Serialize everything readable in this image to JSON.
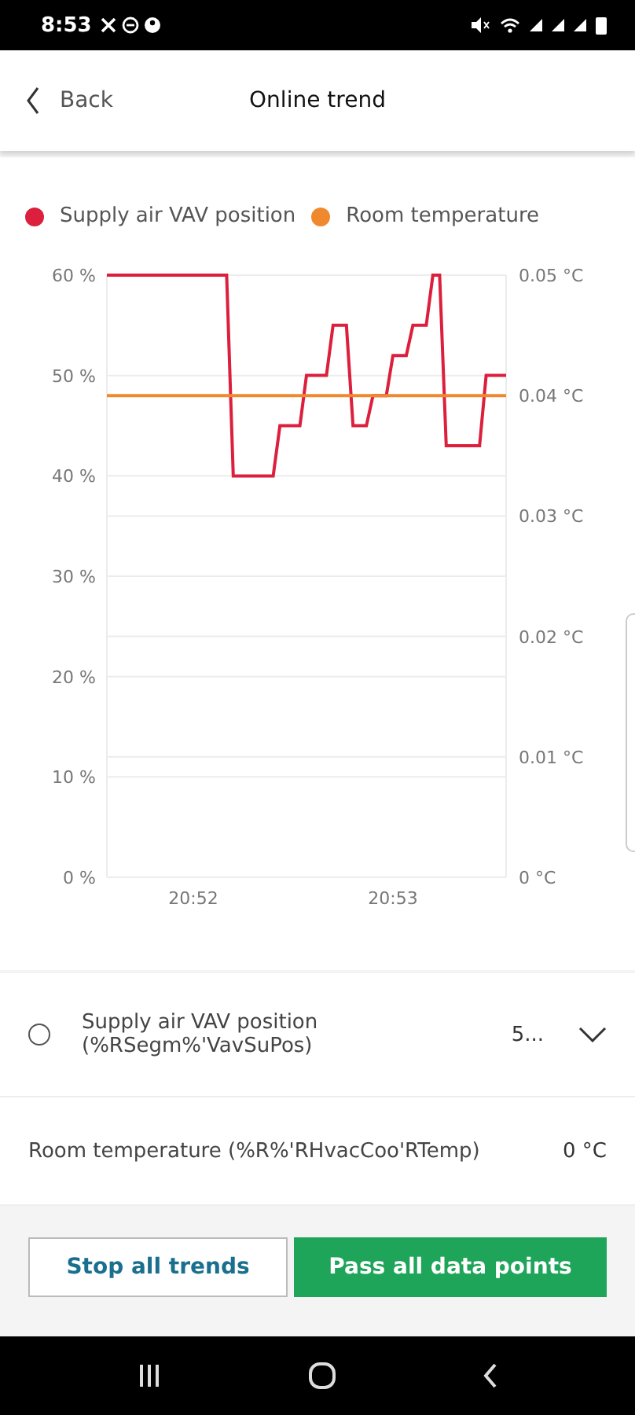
{
  "status_bar": {
    "time": "8:53"
  },
  "header": {
    "back": "Back",
    "title": "Online trend"
  },
  "chart_data": {
    "type": "line",
    "grid": true,
    "categories": [
      null,
      null,
      null,
      null,
      null,
      null,
      null,
      null,
      null,
      null,
      null,
      null,
      null,
      "20:52",
      null,
      null,
      null,
      null,
      null,
      null,
      null,
      null,
      null,
      null,
      null,
      null,
      null,
      null,
      null,
      null,
      null,
      null,
      null,
      null,
      null,
      null,
      null,
      null,
      null,
      null,
      null,
      null,
      null,
      "20:53",
      null,
      null,
      null,
      null,
      null,
      null,
      null,
      null,
      null,
      null,
      null,
      null,
      null,
      null,
      null,
      null,
      null
    ],
    "ylim": [
      0,
      60
    ],
    "yticks": [
      {
        "value": 0,
        "label": "0 %"
      },
      {
        "value": 10,
        "label": "10 %"
      },
      {
        "value": 20,
        "label": "20 %"
      },
      {
        "value": 30,
        "label": "30 %"
      },
      {
        "value": 40,
        "label": "40 %"
      },
      {
        "value": 50,
        "label": "50 %"
      },
      {
        "value": 60,
        "label": "60 %"
      }
    ],
    "y2lim": [
      0,
      0.05
    ],
    "y2ticks": [
      {
        "value": 0,
        "label": "0 °C"
      },
      {
        "value": 0.01,
        "label": "0.01 °C"
      },
      {
        "value": 0.02,
        "label": "0.02 °C"
      },
      {
        "value": 0.03,
        "label": "0.03 °C"
      },
      {
        "value": 0.04,
        "label": "0.04 °C"
      },
      {
        "value": 0.05,
        "label": "0.05 °C"
      }
    ],
    "series": [
      {
        "name": "Supply air VAV position",
        "color": "#dc1f3c",
        "values": [
          60,
          60,
          60,
          60,
          60,
          60,
          60,
          60,
          60,
          60,
          60,
          60,
          60,
          60,
          60,
          60,
          60,
          60,
          60,
          40,
          40,
          40,
          40,
          40,
          40,
          40,
          45,
          45,
          45,
          45,
          50,
          50,
          50,
          50,
          55,
          55,
          55,
          45,
          45,
          45,
          48,
          48,
          48,
          52,
          52,
          52,
          55,
          55,
          55,
          60,
          60,
          43,
          43,
          43,
          43,
          43,
          43,
          50,
          50,
          50,
          50
        ]
      },
      {
        "name": "Room temperature",
        "color": "#f0892e",
        "axis": "y2",
        "values": [
          0.04,
          0.04,
          0.04,
          0.04,
          0.04,
          0.04,
          0.04,
          0.04,
          0.04,
          0.04,
          0.04,
          0.04,
          0.04,
          0.04,
          0.04,
          0.04,
          0.04,
          0.04,
          0.04,
          0.04,
          0.04,
          0.04,
          0.04,
          0.04,
          0.04,
          0.04,
          0.04,
          0.04,
          0.04,
          0.04,
          0.04,
          0.04,
          0.04,
          0.04,
          0.04,
          0.04,
          0.04,
          0.04,
          0.04,
          0.04,
          0.04,
          0.04,
          0.04,
          0.04,
          0.04,
          0.04,
          0.04,
          0.04,
          0.04,
          0.04,
          0.04,
          0.04,
          0.04,
          0.04,
          0.04,
          0.04,
          0.04,
          0.04,
          0.04,
          0.04,
          0.04
        ]
      }
    ]
  },
  "data_points": [
    {
      "kind": "selectable",
      "label": "Supply air VAV position (%RSegm%'VavSuPos)",
      "value": "5...",
      "selected": false,
      "expanded": false
    },
    {
      "kind": "plain",
      "label": "Room temperature (%R%'RHvacCoo'RTemp)",
      "value": "0 °C"
    }
  ],
  "buttons": [
    {
      "label": "Stop all trends",
      "kind": "outline"
    },
    {
      "label": "Pass all data points",
      "kind": "primary"
    }
  ]
}
